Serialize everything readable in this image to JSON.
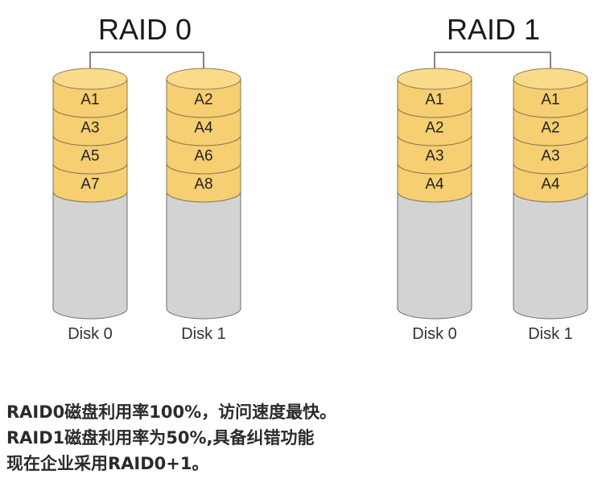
{
  "colors": {
    "data_band": "#f6cf72",
    "data_band_top": "#f9db8a",
    "band_border": "#8a7a55",
    "empty_area": "#d3d3d3",
    "outline": "#6e6e6e",
    "connector": "#333333",
    "text": "#2b2b2b"
  },
  "arrays": [
    {
      "title": "RAID 0",
      "disks": [
        {
          "label": "Disk 0",
          "blocks": [
            "A1",
            "A3",
            "A5",
            "A7"
          ]
        },
        {
          "label": "Disk 1",
          "blocks": [
            "A2",
            "A4",
            "A6",
            "A8"
          ]
        }
      ]
    },
    {
      "title": "RAID 1",
      "disks": [
        {
          "label": "Disk 0",
          "blocks": [
            "A1",
            "A2",
            "A3",
            "A4"
          ]
        },
        {
          "label": "Disk 1",
          "blocks": [
            "A1",
            "A2",
            "A3",
            "A4"
          ]
        }
      ]
    }
  ],
  "notes": [
    "RAID0磁盘利用率100%，访问速度最快。",
    "RAID1磁盘利用率为50%,具备纠错功能",
    "现在企业采用RAID0+1。"
  ]
}
